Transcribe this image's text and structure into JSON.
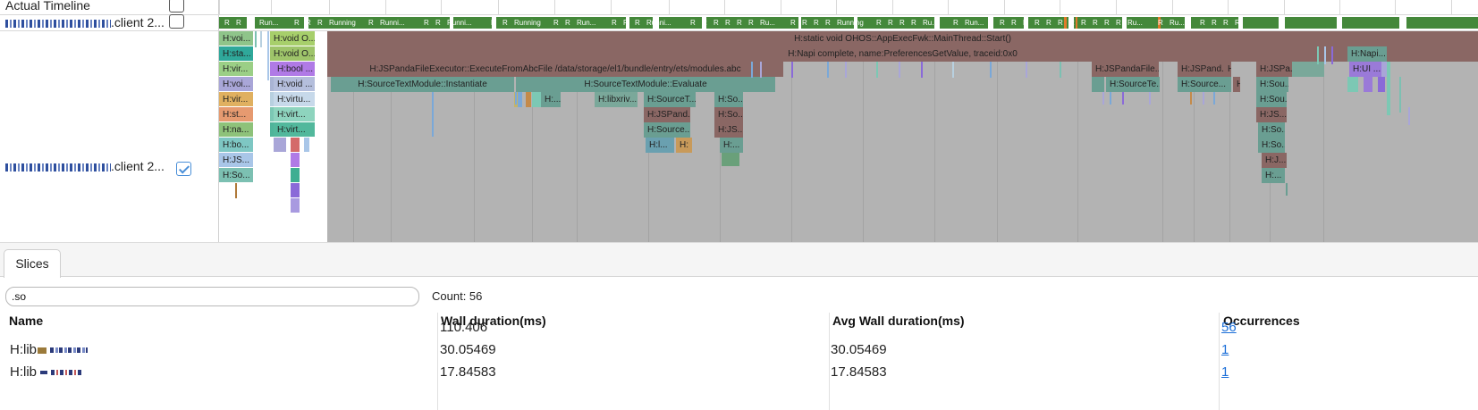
{
  "rows": {
    "actual_timeline_label": "Actual Timeline",
    "process_row_1_suffix": ".client 2...",
    "process_row_2_suffix": ".client 2..."
  },
  "timeline": {
    "states": [
      "R",
      "R",
      "R",
      "Run...",
      "R",
      "R",
      "R",
      "Running",
      "R",
      "Runni...",
      "R",
      "R",
      "Runni...",
      "R",
      "R",
      "Running",
      "R",
      "R",
      "Run...",
      "R",
      "R",
      "R",
      "Runni...",
      "R",
      "R",
      "R",
      "R",
      "R",
      "R",
      "Ru...",
      "R",
      "R",
      "R",
      "R",
      "Running",
      "R",
      "R",
      "R",
      "R",
      "Ru...",
      "R",
      "Run...",
      "R",
      "R",
      "R",
      "R",
      "R",
      "R",
      "R",
      "R",
      "R",
      "R",
      "R",
      "Ru...",
      "R",
      "Ru...",
      "R",
      "R",
      "R",
      "R"
    ],
    "slices": {
      "main_thread": "H:static void OHOS::AppExecFwk::MainThread::Start()",
      "napi_complete": "H:Napi complete, name:PreferencesGetValue, traceid:0x0",
      "js_panda_exec": "H:JSPandaFileExecutor::ExecuteFromAbcFile /data/storage/el1/bundle/entry/ets/modules.abc",
      "stm_instantiate": "H:SourceTextModule::Instantiate",
      "stm_evaluate": "H:SourceTextModule::Evaluate",
      "col1": [
        "H:voi...",
        "H:sta...",
        "H:vir...",
        "H:voi...",
        "H:vir...",
        "H:st...",
        "H:na...",
        "H:bo...",
        "H:JS...",
        "H:So..."
      ],
      "col2": [
        "H:void O...",
        "H:void O...",
        "H:bool ...",
        "H:void ...",
        "H:virtu...",
        "H:virt...",
        "H:virt..."
      ],
      "mid_a": [
        "H:...",
        "H:libxriv...",
        "H:SourceT...",
        "H:JSPand...",
        "H:Source...",
        "H:l...",
        "H:"
      ],
      "mid_b": [
        "H:So...",
        "H:So...",
        "H:JS...",
        "H:..."
      ],
      "right_a": [
        "H:JSPandaFile...",
        "H:SourceTe...",
        "H:JSPand...",
        "H:Source...",
        "H:",
        "H:"
      ],
      "right_b": [
        "H:JSPa...",
        "H:Sou...",
        "H:Sou...",
        "H:JS...",
        "H:So...",
        "H:So...",
        "H:J...",
        "H:..."
      ],
      "far_right": [
        "H:Napi...",
        "H:UI ..."
      ]
    }
  },
  "panel": {
    "tab_label": "Slices",
    "filter_value": ".so",
    "count_text": "Count: 56",
    "columns": [
      "Name",
      "Wall duration(ms)",
      "Avg Wall duration(ms)",
      "Occurrences"
    ],
    "rows": [
      {
        "name": "",
        "wall": "110.406",
        "avg": "",
        "occ": "56"
      },
      {
        "name": "H:lib",
        "wall": "30.05469",
        "avg": "30.05469",
        "occ": "1"
      },
      {
        "name": "H:lib",
        "wall": "17.84583",
        "avg": "17.84583",
        "occ": "1"
      }
    ]
  },
  "colors": {
    "running": "#44883a",
    "main_thread": "#8a6764",
    "instantiate": "#6a9e92",
    "gray_fill": "#b3b3b3"
  }
}
